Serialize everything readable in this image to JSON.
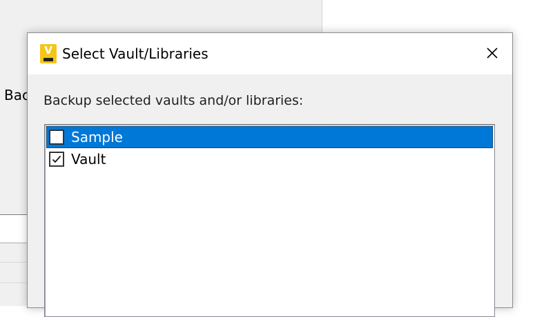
{
  "background_window": {
    "partial_label": "Bac"
  },
  "dialog": {
    "title": "Select Vault/Libraries",
    "app_icon_letter": "V",
    "prompt": "Backup selected vaults and/or libraries:",
    "items": [
      {
        "label": "Sample",
        "checked": false,
        "selected": true
      },
      {
        "label": "Vault",
        "checked": true,
        "selected": false
      }
    ]
  },
  "colors": {
    "selection": "#0078d7",
    "icon": "#f5c518",
    "dialog_bg": "#f0f0f0"
  }
}
